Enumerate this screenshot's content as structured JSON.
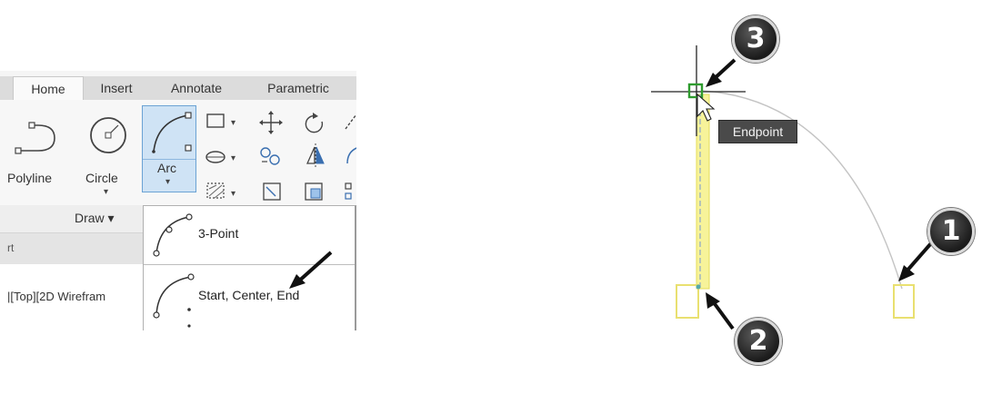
{
  "ribbon": {
    "tabs": [
      {
        "label": "Home",
        "active": true
      },
      {
        "label": "Insert",
        "active": false
      },
      {
        "label": "Annotate",
        "active": false
      },
      {
        "label": "Parametric",
        "active": false
      }
    ],
    "tools": {
      "polyline_label": "Polyline",
      "circle_label": "Circle",
      "arc_label": "Arc"
    },
    "group_label": "Draw ▾",
    "file_tab_label": "rt",
    "viewport_label": "|[Top][2D Wirefram"
  },
  "arc_dropdown": {
    "items": [
      {
        "label": "3-Point"
      },
      {
        "label": "Start, Center, End"
      }
    ]
  },
  "drawing": {
    "tooltip": "Endpoint",
    "callouts": [
      "1",
      "2",
      "3"
    ],
    "colors": {
      "highlight": "#f3ee77",
      "snap_marker": "#2e9b2e",
      "arc_line": "#bdbdbd",
      "crosshair": "#222222",
      "badge": "#1f1f1f"
    }
  }
}
